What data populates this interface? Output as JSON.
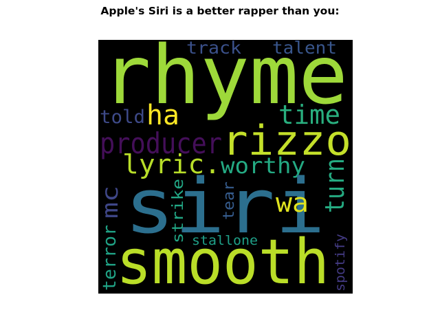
{
  "title": "Apple's Siri is a better rapper than you:",
  "words": [
    {
      "text": "rhyme",
      "color": "#9ed93a"
    },
    {
      "text": "siri",
      "color": "#2c6f8e"
    },
    {
      "text": "smooth",
      "color": "#bade28"
    },
    {
      "text": "rizzo",
      "color": "#c4e02a"
    },
    {
      "text": "producer",
      "color": "#440f59"
    },
    {
      "text": "time",
      "color": "#29af7f"
    },
    {
      "text": "lyric.",
      "color": "#b8de29"
    },
    {
      "text": "worthy",
      "color": "#24aa83"
    },
    {
      "text": "ha",
      "color": "#fde725"
    },
    {
      "text": "told",
      "color": "#3e4a89"
    },
    {
      "text": "track",
      "color": "#3b518b"
    },
    {
      "text": "talent",
      "color": "#39568c"
    },
    {
      "text": "wa",
      "color": "#e0e31f"
    },
    {
      "text": "turn",
      "color": "#25ab82"
    },
    {
      "text": "mc",
      "color": "#3f4788"
    },
    {
      "text": "terror",
      "color": "#20a386"
    },
    {
      "text": "strike",
      "color": "#22a785"
    },
    {
      "text": "tear",
      "color": "#365c8d"
    },
    {
      "text": "stallone",
      "color": "#1fa088"
    },
    {
      "text": "spotify",
      "color": "#443b84"
    }
  ]
}
